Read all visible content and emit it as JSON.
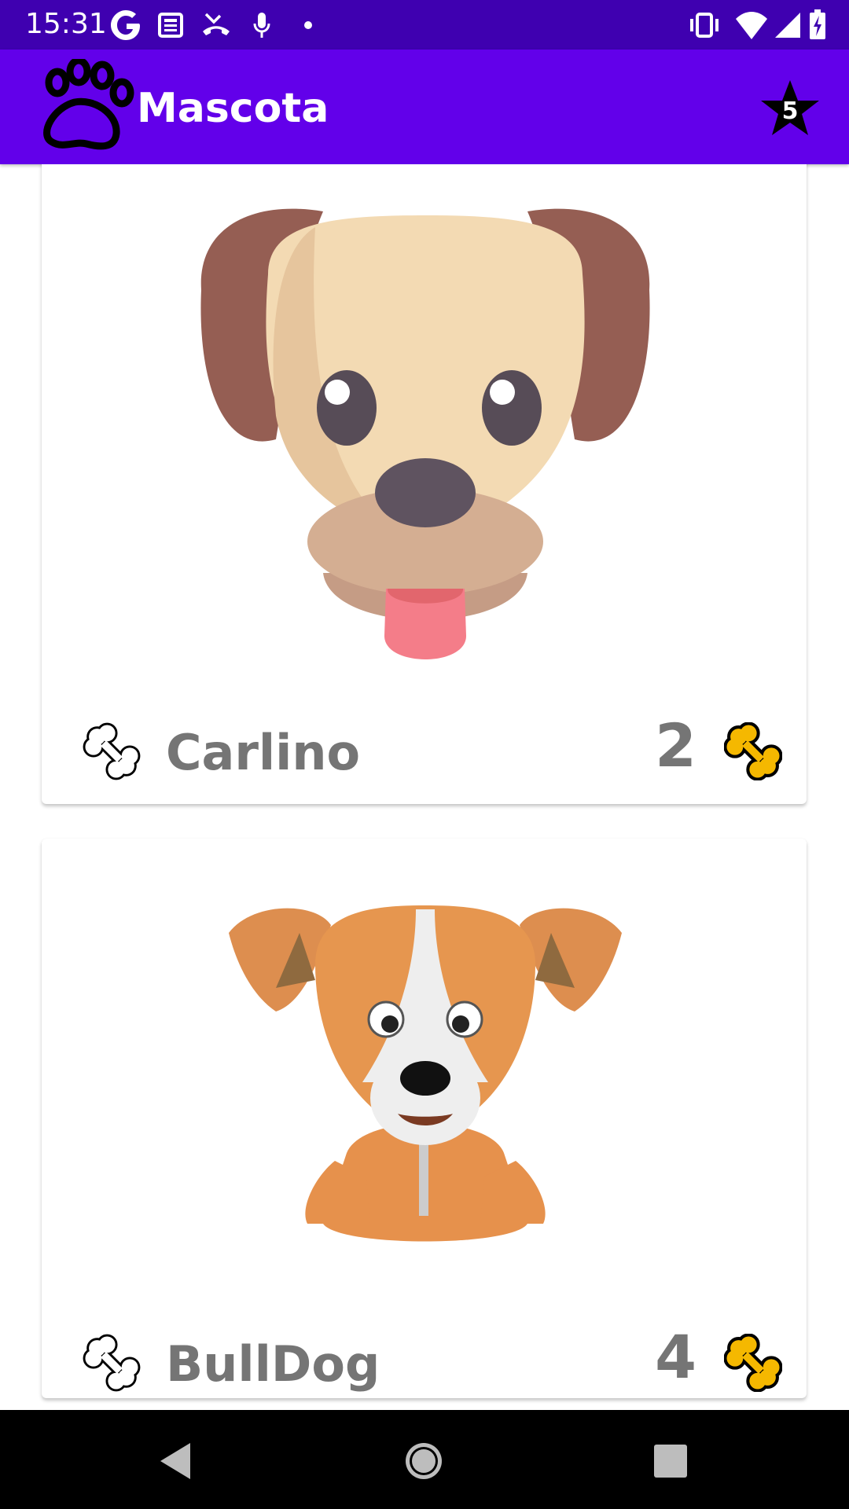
{
  "status_bar": {
    "time": "15:31",
    "icons": [
      "google-icon",
      "news-icon",
      "missed-call-icon",
      "mic-icon",
      "dot-icon",
      "vibrate-icon",
      "wifi-icon",
      "signal-icon",
      "battery-charging-icon"
    ]
  },
  "app_bar": {
    "title": "Mascota",
    "logo_icon": "paw-icon",
    "rating_icon": "star-icon",
    "rating_count": "5",
    "colors": {
      "background": "#6200ea",
      "status_bar": "#3f00b0"
    }
  },
  "pets": [
    {
      "name": "Carlino",
      "rating": "2",
      "image": "puppy-face-illustration",
      "like_icon": "bone-outline-icon",
      "rating_icon": "bone-gold-icon"
    },
    {
      "name": "BullDog",
      "rating": "4",
      "image": "sitting-dog-illustration",
      "like_icon": "bone-outline-icon",
      "rating_icon": "bone-gold-icon"
    }
  ],
  "nav_bar": {
    "icons": [
      "back-icon",
      "home-icon",
      "recents-icon"
    ]
  }
}
